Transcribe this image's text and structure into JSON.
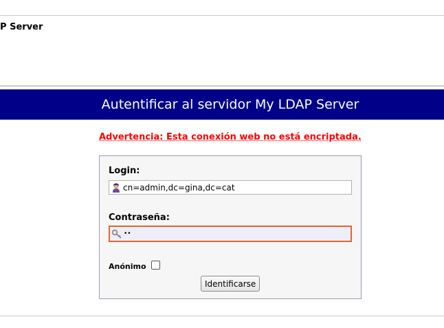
{
  "header": {
    "server_name": "AP Server"
  },
  "banner": {
    "title": "Autentificar al servidor My LDAP Server"
  },
  "warning": {
    "text": "Advertencia: Esta conexión web no está encriptada."
  },
  "form": {
    "login_label": "Login:",
    "login_value": "cn=admin,dc=gina,dc=cat",
    "password_label": "Contraseña:",
    "password_value": "••",
    "anonymous_label": "Anónimo",
    "anonymous_checked": false,
    "submit_label": "Identificarse"
  },
  "colors": {
    "banner_bg": "#000088",
    "warning": "#ff0000",
    "focus_border": "#e0662a"
  },
  "icons": {
    "login": "user-icon",
    "password": "key-icon"
  }
}
